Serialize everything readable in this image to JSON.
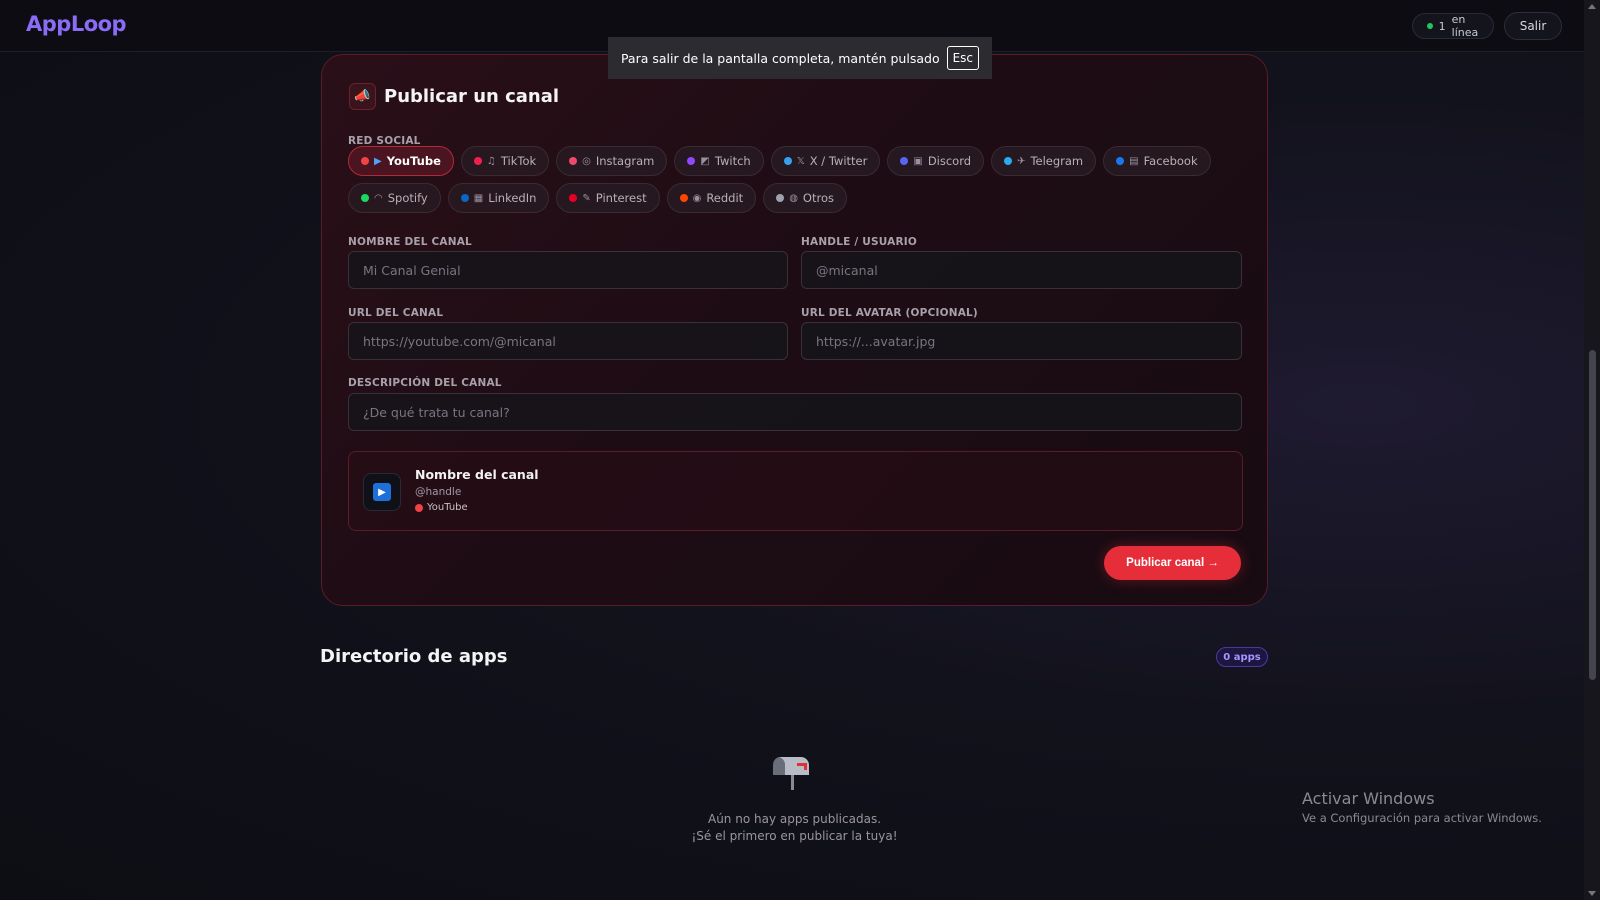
{
  "header": {
    "logo": "AppLoop",
    "online_count": "1",
    "online_label": "en línea",
    "exit_label": "Salir"
  },
  "fullscreen_notice": {
    "text": "Para salir de la pantalla completa, mantén pulsado",
    "key": "Esc"
  },
  "publish_card": {
    "icon": "megaphone-icon",
    "title": "Publicar un canal",
    "social_label": "RED SOCIAL",
    "networks_row1": [
      {
        "label": "YouTube",
        "color": "#ef4444",
        "glyph": "▶",
        "active": true
      },
      {
        "label": "TikTok",
        "color": "#ef2050",
        "glyph": "♫",
        "active": false
      },
      {
        "label": "Instagram",
        "color": "#ec4870",
        "glyph": "◎",
        "active": false
      },
      {
        "label": "Twitch",
        "color": "#9146ff",
        "glyph": "◩",
        "active": false
      },
      {
        "label": "X / Twitter",
        "color": "#38a0f0",
        "glyph": "𝕏",
        "active": false
      },
      {
        "label": "Discord",
        "color": "#5865f2",
        "glyph": "▣",
        "active": false
      },
      {
        "label": "Telegram",
        "color": "#2aabee",
        "glyph": "✈",
        "active": false
      },
      {
        "label": "Facebook",
        "color": "#1877f2",
        "glyph": "▤",
        "active": false
      }
    ],
    "networks_row2": [
      {
        "label": "Spotify",
        "color": "#1ed760",
        "glyph": "◠",
        "active": false
      },
      {
        "label": "LinkedIn",
        "color": "#0a66c2",
        "glyph": "▦",
        "active": false
      },
      {
        "label": "Pinterest",
        "color": "#e60023",
        "glyph": "✎",
        "active": false
      },
      {
        "label": "Reddit",
        "color": "#ff4500",
        "glyph": "◉",
        "active": false
      },
      {
        "label": "Otros",
        "color": "#9ca3af",
        "glyph": "◍",
        "active": false
      }
    ],
    "name_label": "NOMBRE DEL CANAL",
    "name_placeholder": "Mi Canal Genial",
    "handle_label": "HANDLE / USUARIO",
    "handle_placeholder": "@micanal",
    "url_label": "URL DEL CANAL",
    "url_placeholder": "https://youtube.com/@micanal",
    "avatar_label": "URL DEL AVATAR (OPCIONAL)",
    "avatar_placeholder": "https://...avatar.jpg",
    "desc_label": "DESCRIPCIÓN DEL CANAL",
    "desc_placeholder": "¿De qué trata tu canal?",
    "preview": {
      "name": "Nombre del canal",
      "handle": "@handle",
      "network": "YouTube",
      "network_color": "#ef4444"
    },
    "publish_button": "Publicar canal →"
  },
  "directory": {
    "title": "Directorio de apps",
    "count_badge": "0 apps",
    "empty_icon": "mailbox-icon",
    "empty_line1": "Aún no hay apps publicadas.",
    "empty_line2": "¡Sé el primero en publicar la tuya!"
  },
  "windows_watermark": {
    "title": "Activar Windows",
    "subtitle": "Ve a Configuración para activar Windows."
  }
}
